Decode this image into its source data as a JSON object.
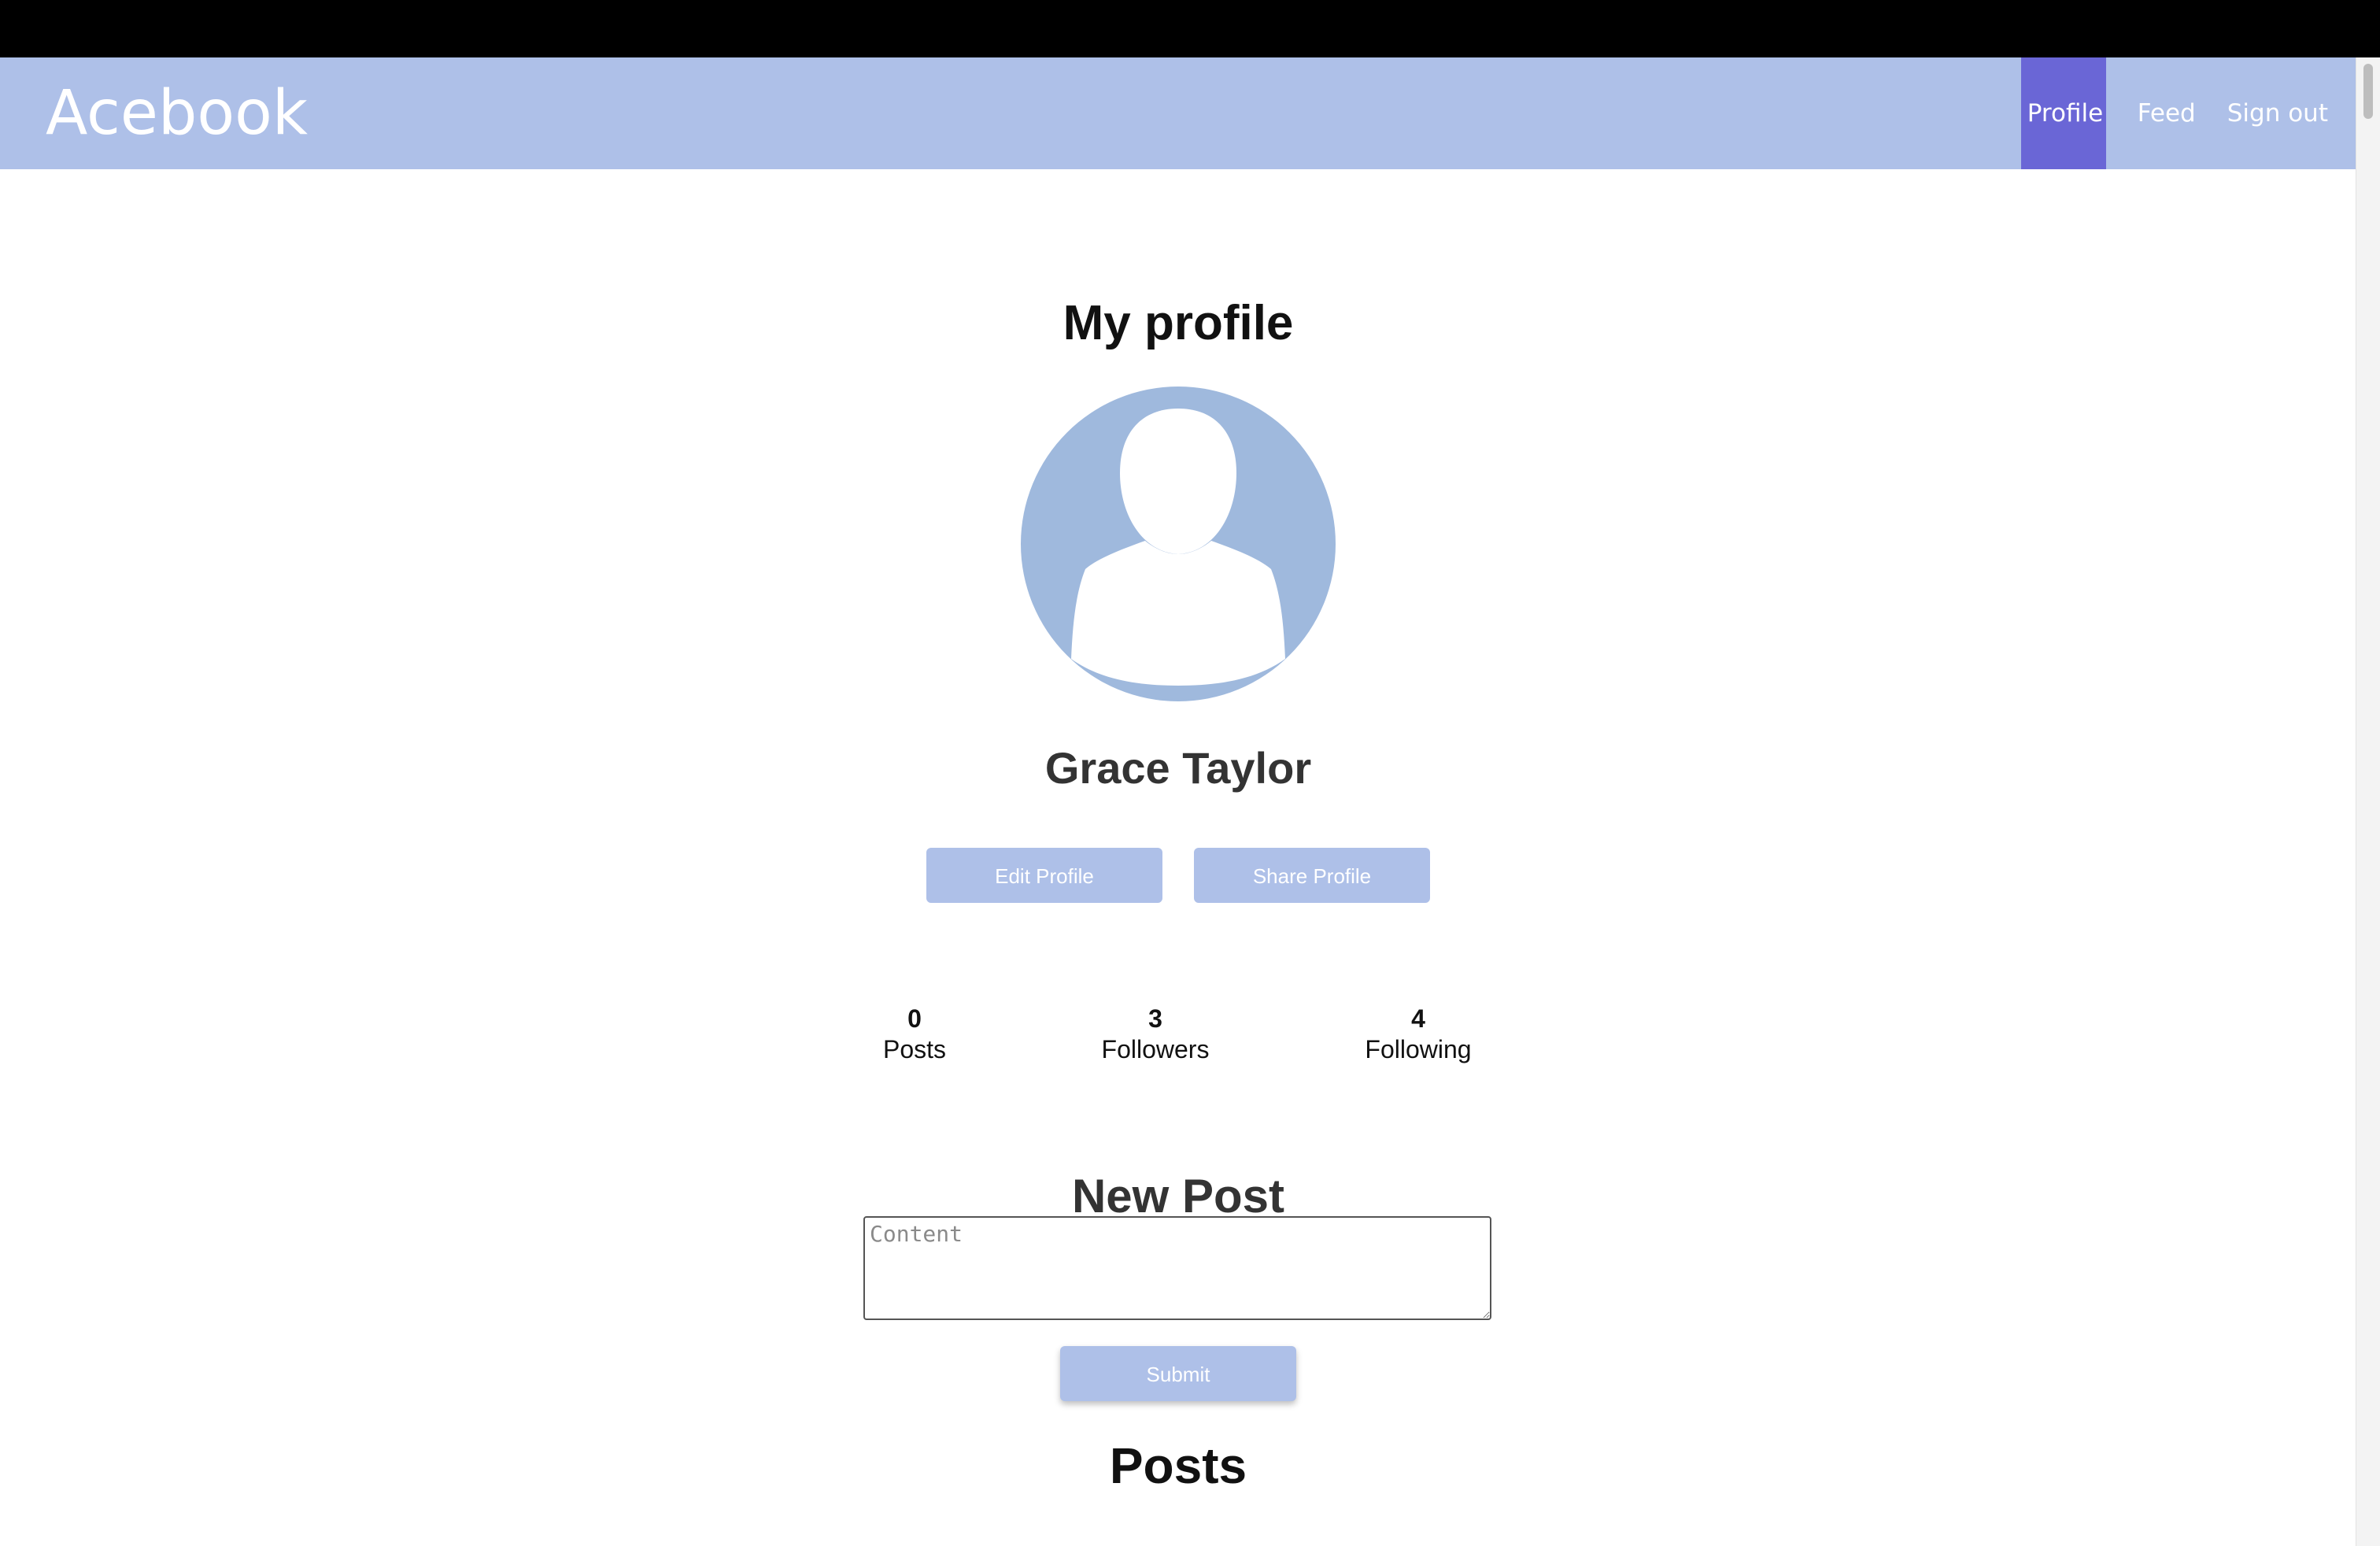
{
  "navbar": {
    "brand": "Acebook",
    "links": [
      {
        "label": "Profile",
        "active": true
      },
      {
        "label": "Feed",
        "active": false
      },
      {
        "label": "Sign out",
        "active": false
      }
    ]
  },
  "profile": {
    "page_title": "My profile",
    "avatar_icon": "default-user-avatar-icon",
    "name": "Grace Taylor",
    "edit_label": "Edit Profile",
    "share_label": "Share Profile",
    "stats": [
      {
        "value": "0",
        "label": "Posts"
      },
      {
        "value": "3",
        "label": "Followers"
      },
      {
        "value": "4",
        "label": "Following"
      }
    ]
  },
  "new_post": {
    "title": "New Post",
    "placeholder": "Content",
    "submit_label": "Submit"
  },
  "posts": {
    "title": "Posts"
  },
  "colors": {
    "navbar_bg": "#aec0e8",
    "nav_active_bg": "#6a66d6",
    "button_bg": "#aec0e8",
    "avatar_bg": "#9fb9dd"
  }
}
